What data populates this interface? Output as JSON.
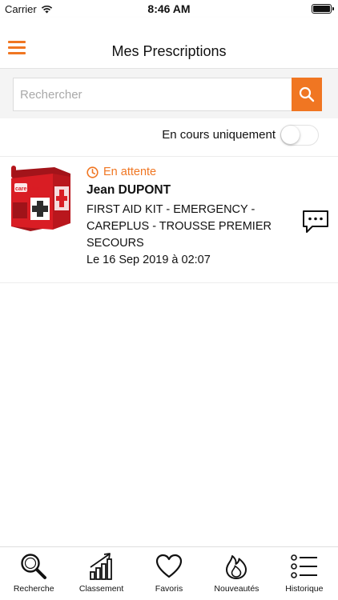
{
  "status_bar": {
    "carrier": "Carrier",
    "time": "8:46 AM"
  },
  "nav": {
    "title": "Mes Prescriptions"
  },
  "search": {
    "placeholder": "Rechercher"
  },
  "filter": {
    "label": "En cours uniquement",
    "enabled": false
  },
  "prescriptions": [
    {
      "status": "En attente",
      "patient": "Jean DUPONT",
      "product": "FIRST AID KIT - EMERGENCY - CAREPLUS - TROUSSE PREMIER SECOURS",
      "date": "Le 16 Sep 2019 à 02:07",
      "image_brand": "care plus"
    }
  ],
  "tabs": [
    {
      "label": "Recherche",
      "icon": "search-icon"
    },
    {
      "label": "Classement",
      "icon": "ranking-chart-icon"
    },
    {
      "label": "Favoris",
      "icon": "heart-icon"
    },
    {
      "label": "Nouveautés",
      "icon": "flame-icon"
    },
    {
      "label": "Historique",
      "icon": "list-icon"
    }
  ],
  "colors": {
    "accent": "#f07622",
    "kit_red": "#d91d24"
  }
}
